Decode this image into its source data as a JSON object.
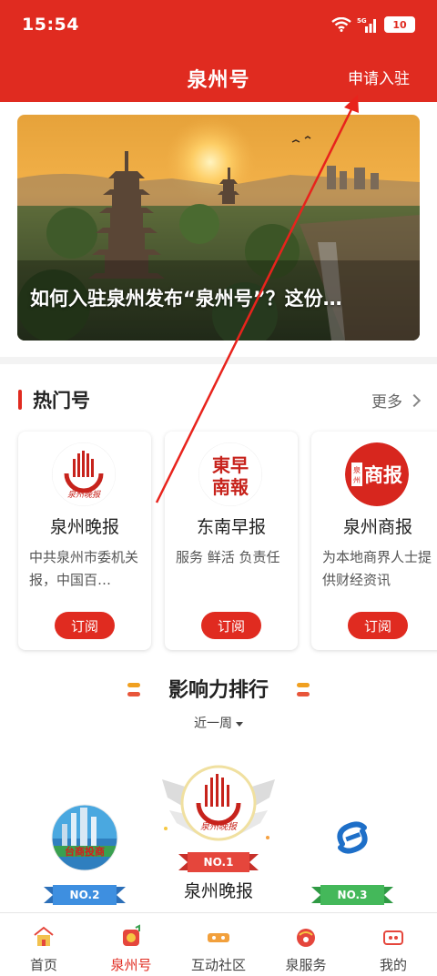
{
  "status": {
    "time": "15:54",
    "network": "5G",
    "battery": "10"
  },
  "header": {
    "title": "泉州号",
    "apply_label": "申请入驻"
  },
  "banner": {
    "title": "如何入驻泉州发布“泉州号”？这份…"
  },
  "hot": {
    "title": "热门号",
    "more_label": "更多",
    "cards": [
      {
        "name": "泉州晚报",
        "desc": "中共泉州市委机关报，中国百…",
        "button": "订阅",
        "logo_text": "泉州晚报"
      },
      {
        "name": "东南早报",
        "desc": "服务 鲜活 负责任",
        "button": "订阅",
        "logo_text": "東早南報"
      },
      {
        "name": "泉州商报",
        "desc": "为本地商界人士提供财经资讯",
        "button": "订阅",
        "logo_text": "泉州商报"
      }
    ]
  },
  "ranking": {
    "title": "影响力排行",
    "period": "近一周",
    "items": [
      {
        "rank": "NO.1",
        "name": "泉州晚报"
      },
      {
        "rank": "NO.2"
      },
      {
        "rank": "NO.3"
      }
    ]
  },
  "nav": [
    {
      "label": "首页",
      "icon": "home-icon"
    },
    {
      "label": "泉州号",
      "icon": "quanzhouhao-icon",
      "active": true
    },
    {
      "label": "互动社区",
      "icon": "community-icon"
    },
    {
      "label": "泉服务",
      "icon": "service-icon"
    },
    {
      "label": "我的",
      "icon": "profile-icon"
    }
  ],
  "colors": {
    "brand": "#e02b20",
    "no1": "#e5463c",
    "no2": "#3e8fe0",
    "no3": "#44b85a"
  }
}
